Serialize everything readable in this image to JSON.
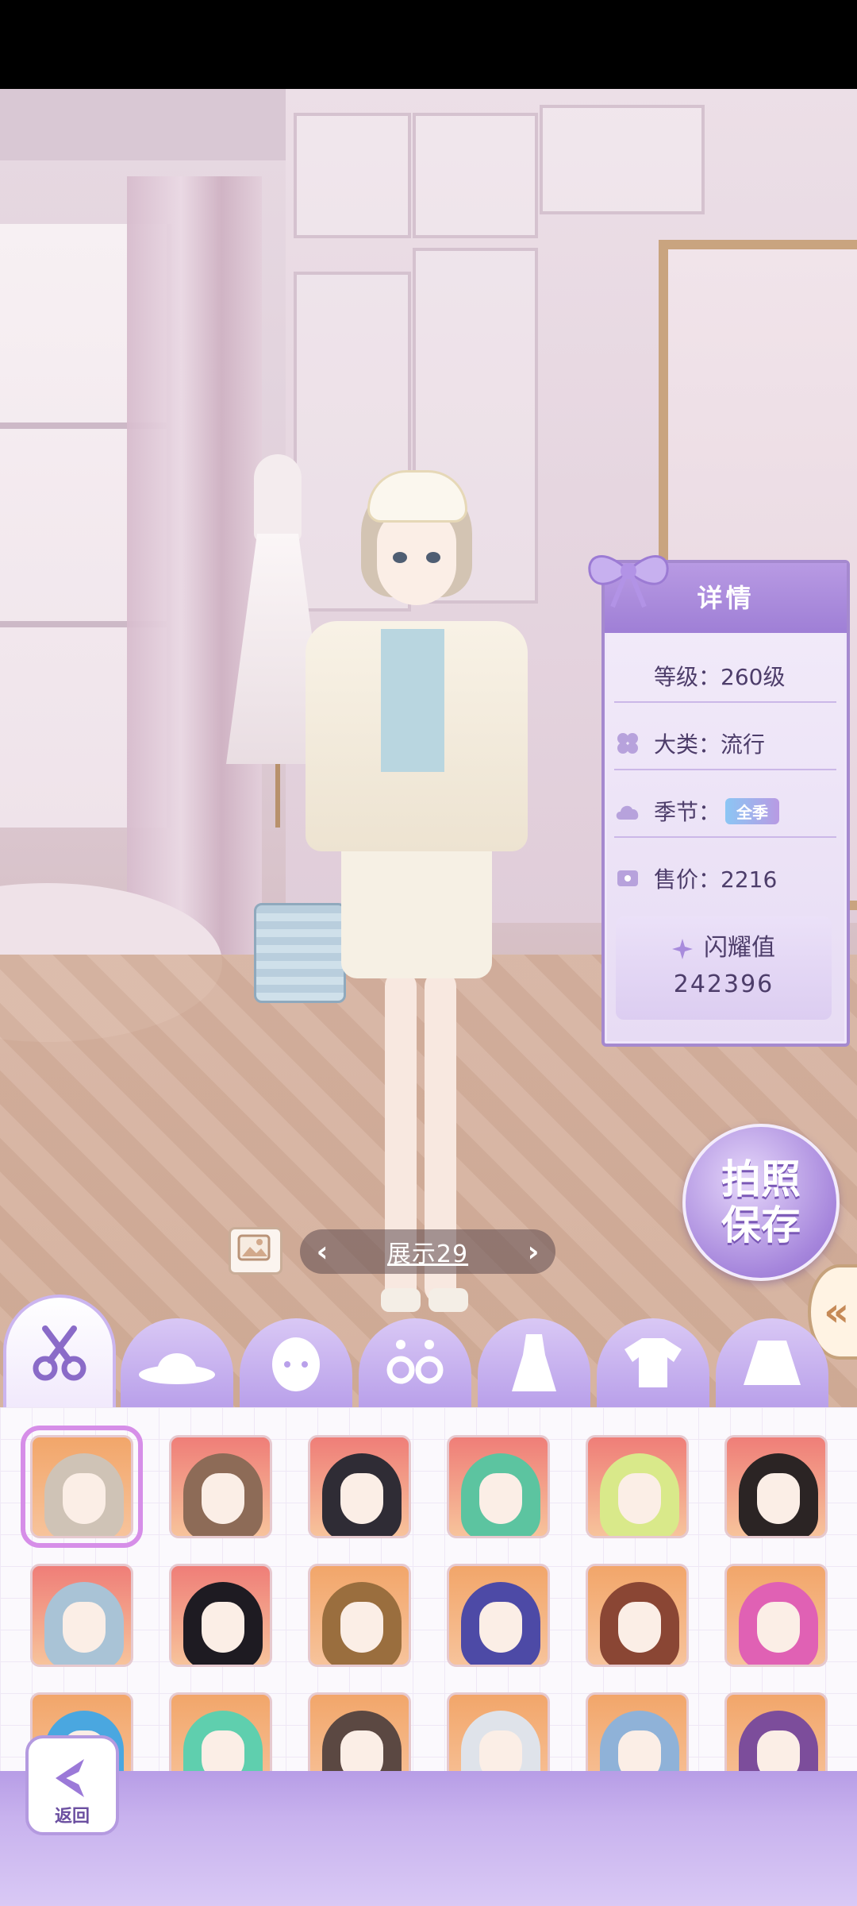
{
  "details": {
    "title": "详情",
    "level": "等级：260级",
    "category": "大类：流行",
    "season_label": "季节：",
    "season_badge": "全季",
    "price": "售价：2216",
    "sparkle_label": "闪耀值",
    "sparkle_value": "242396"
  },
  "photo_save": {
    "line1": "拍照",
    "line2": "保存"
  },
  "showcase": {
    "label": "展示29",
    "prev_icon": "chevron-left-icon",
    "next_icon": "chevron-right-icon"
  },
  "category_tabs": [
    {
      "icon": "scissors-icon",
      "active": true
    },
    {
      "icon": "hat-icon",
      "active": false
    },
    {
      "icon": "face-icon",
      "active": false
    },
    {
      "icon": "earrings-icon",
      "active": false
    },
    {
      "icon": "dress-icon",
      "active": false
    },
    {
      "icon": "top-icon",
      "active": false
    },
    {
      "icon": "skirt-icon",
      "active": false
    }
  ],
  "hair_items": [
    {
      "hair_color": "#cfc3b6",
      "bg": "#f2a66a",
      "selected": true
    },
    {
      "hair_color": "#8d6b57",
      "bg": "#ef7e78"
    },
    {
      "hair_color": "#2f2c35",
      "bg": "#ef7e78"
    },
    {
      "hair_color": "#5cc4a0",
      "bg": "#ef7e78"
    },
    {
      "hair_color": "#d9e98a",
      "bg": "#ef7e78"
    },
    {
      "hair_color": "#2b2424",
      "bg": "#ef7e78"
    },
    {
      "hair_color": "#a9c3d6",
      "bg": "#ef7e78"
    },
    {
      "hair_color": "#1e1b22",
      "bg": "#ef7e78"
    },
    {
      "hair_color": "#9a6e3e",
      "bg": "#f2a66a"
    },
    {
      "hair_color": "#4d4aa6",
      "bg": "#f2a66a"
    },
    {
      "hair_color": "#8a4634",
      "bg": "#f2a66a"
    },
    {
      "hair_color": "#e061b4",
      "bg": "#f2a66a"
    },
    {
      "hair_color": "#4aa7e0",
      "bg": "#f2a66a"
    },
    {
      "hair_color": "#5fcfae",
      "bg": "#f2a66a"
    },
    {
      "hair_color": "#5b4842",
      "bg": "#f2a66a"
    },
    {
      "hair_color": "#dfe3ea",
      "bg": "#f2a66a"
    },
    {
      "hair_color": "#8fb2d8",
      "bg": "#f2a66a"
    },
    {
      "hair_color": "#7c4d9b",
      "bg": "#f2a66a"
    }
  ],
  "back_button": {
    "label": "返回"
  },
  "colors": {
    "accent": "#a589cf",
    "panel_header": "#9f7fd6"
  }
}
